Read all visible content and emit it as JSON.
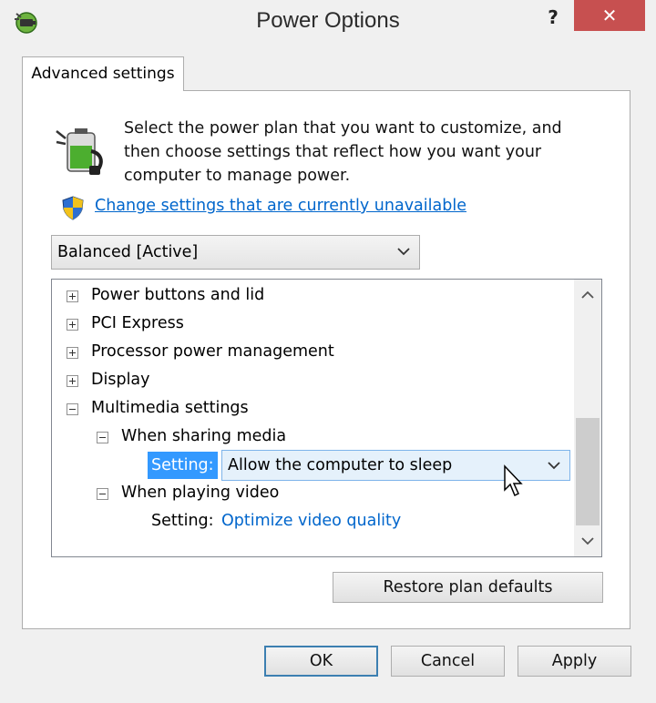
{
  "window": {
    "title": "Power Options",
    "help_label": "?",
    "close_label": "✕"
  },
  "tab": {
    "label": "Advanced settings"
  },
  "intro": {
    "line1": "Select the power plan that you want to customize, and",
    "line2": "then choose settings that reflect how you want your",
    "line3": "computer to manage power."
  },
  "admin_link": {
    "label": "Change settings that are currently unavailable"
  },
  "plan_select": {
    "value": "Balanced [Active]"
  },
  "tree": {
    "items": [
      {
        "label": "Power buttons and lid",
        "expanded": false
      },
      {
        "label": "PCI Express",
        "expanded": false
      },
      {
        "label": "Processor power management",
        "expanded": false
      },
      {
        "label": "Display",
        "expanded": false
      },
      {
        "label": "Multimedia settings",
        "expanded": true
      }
    ],
    "sharing_media": {
      "label": "When sharing media",
      "setting_label": "Setting:",
      "setting_value": "Allow the computer to sleep"
    },
    "playing_video": {
      "label": "When playing video",
      "setting_label": "Setting:",
      "setting_value": "Optimize video quality"
    }
  },
  "buttons": {
    "restore": "Restore plan defaults",
    "ok": "OK",
    "cancel": "Cancel",
    "apply": "Apply"
  },
  "colors": {
    "accent": "#3399ff",
    "link": "#0066cc",
    "close": "#c75050"
  }
}
